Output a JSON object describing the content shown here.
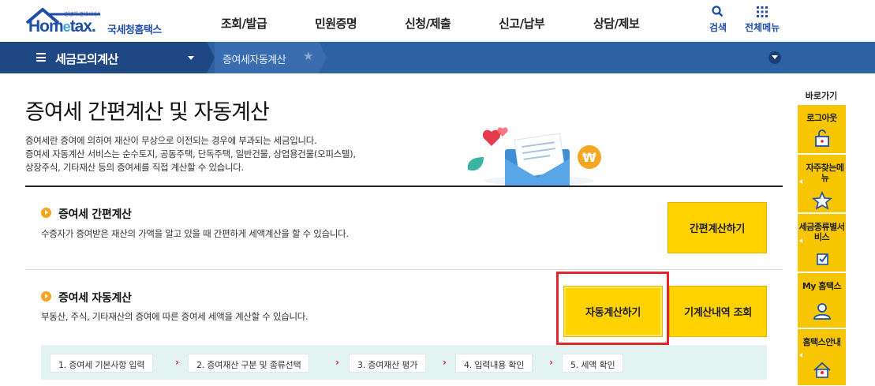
{
  "header": {
    "logo_small": "안녕히 걸세서비스",
    "logo_main": "Hometax",
    "logo_sub": "국세청홈택스",
    "menus": [
      "조회/발급",
      "민원증명",
      "신청/제출",
      "신고/납부",
      "상담/제보"
    ],
    "search_label": "검색",
    "allmenu_label": "전체메뉴",
    "brand_color": "#1f4ea8"
  },
  "location": {
    "title": "세금모의계산",
    "current": "증여세자동계산"
  },
  "main": {
    "title": "증여세 간편계산 및 자동계산",
    "desc": [
      "증여세란 증여에 의하여 재산이 무상으로 이전되는 경우에 부과되는 세금입니다.",
      "증여세 자동계산 서비스는 순수토지, 공동주택, 단독주택, 일반건물, 상업용건물(오피스텔),",
      "상장주식, 기타재산 등의 증여세를 직접 계산할 수 있습니다."
    ],
    "simple": {
      "heading": "증여세 간편계산",
      "desc": "수증자가 증여받은 재산의 가액을 알고 있을 때 간편하게 세액계산을 할 수 있습니다.",
      "button": "간편계산하기"
    },
    "auto": {
      "heading": "증여세 자동계산",
      "desc": "부동산, 주식, 기타재산의 증여에 따른 증여세 세액을 계산할 수 있습니다.",
      "button": "자동계산하기",
      "history_button": "기계산내역 조회"
    },
    "steps": [
      "1. 증여세 기본사항 입력",
      "2. 증여재산 구분 및 종류선택",
      "3. 증여재산 평가",
      "4. 입력내용 확인",
      "5. 세액 확인"
    ],
    "accent_color": "#ffd200",
    "highlight_color": "#e4262c"
  },
  "quickbar": {
    "title": "바로가기",
    "items": [
      {
        "label": "로그아웃",
        "icon": "unlock-icon"
      },
      {
        "label": "자주찾는메뉴",
        "icon": "star-icon"
      },
      {
        "label": "세금종류별서비스",
        "icon": "checkbox-icon"
      },
      {
        "label": "My 홈택스",
        "icon": "user-icon"
      },
      {
        "label": "홈택스안내",
        "icon": "info-icon"
      }
    ]
  }
}
